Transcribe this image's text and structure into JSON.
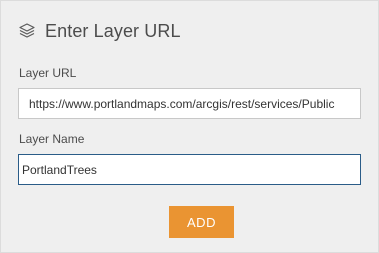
{
  "header": {
    "icon": "layers-icon",
    "title": "Enter Layer URL"
  },
  "form": {
    "layer_url": {
      "label": "Layer URL",
      "value": "https://www.portlandmaps.com/arcgis/rest/services/Public"
    },
    "layer_name": {
      "label": "Layer Name",
      "value": "PortlandTrees"
    },
    "add_label": "ADD"
  },
  "colors": {
    "panel_background": "#efefef",
    "accent_button": "#ea9432",
    "focused_border": "#2a5c88",
    "text": "#4c4c4c"
  }
}
